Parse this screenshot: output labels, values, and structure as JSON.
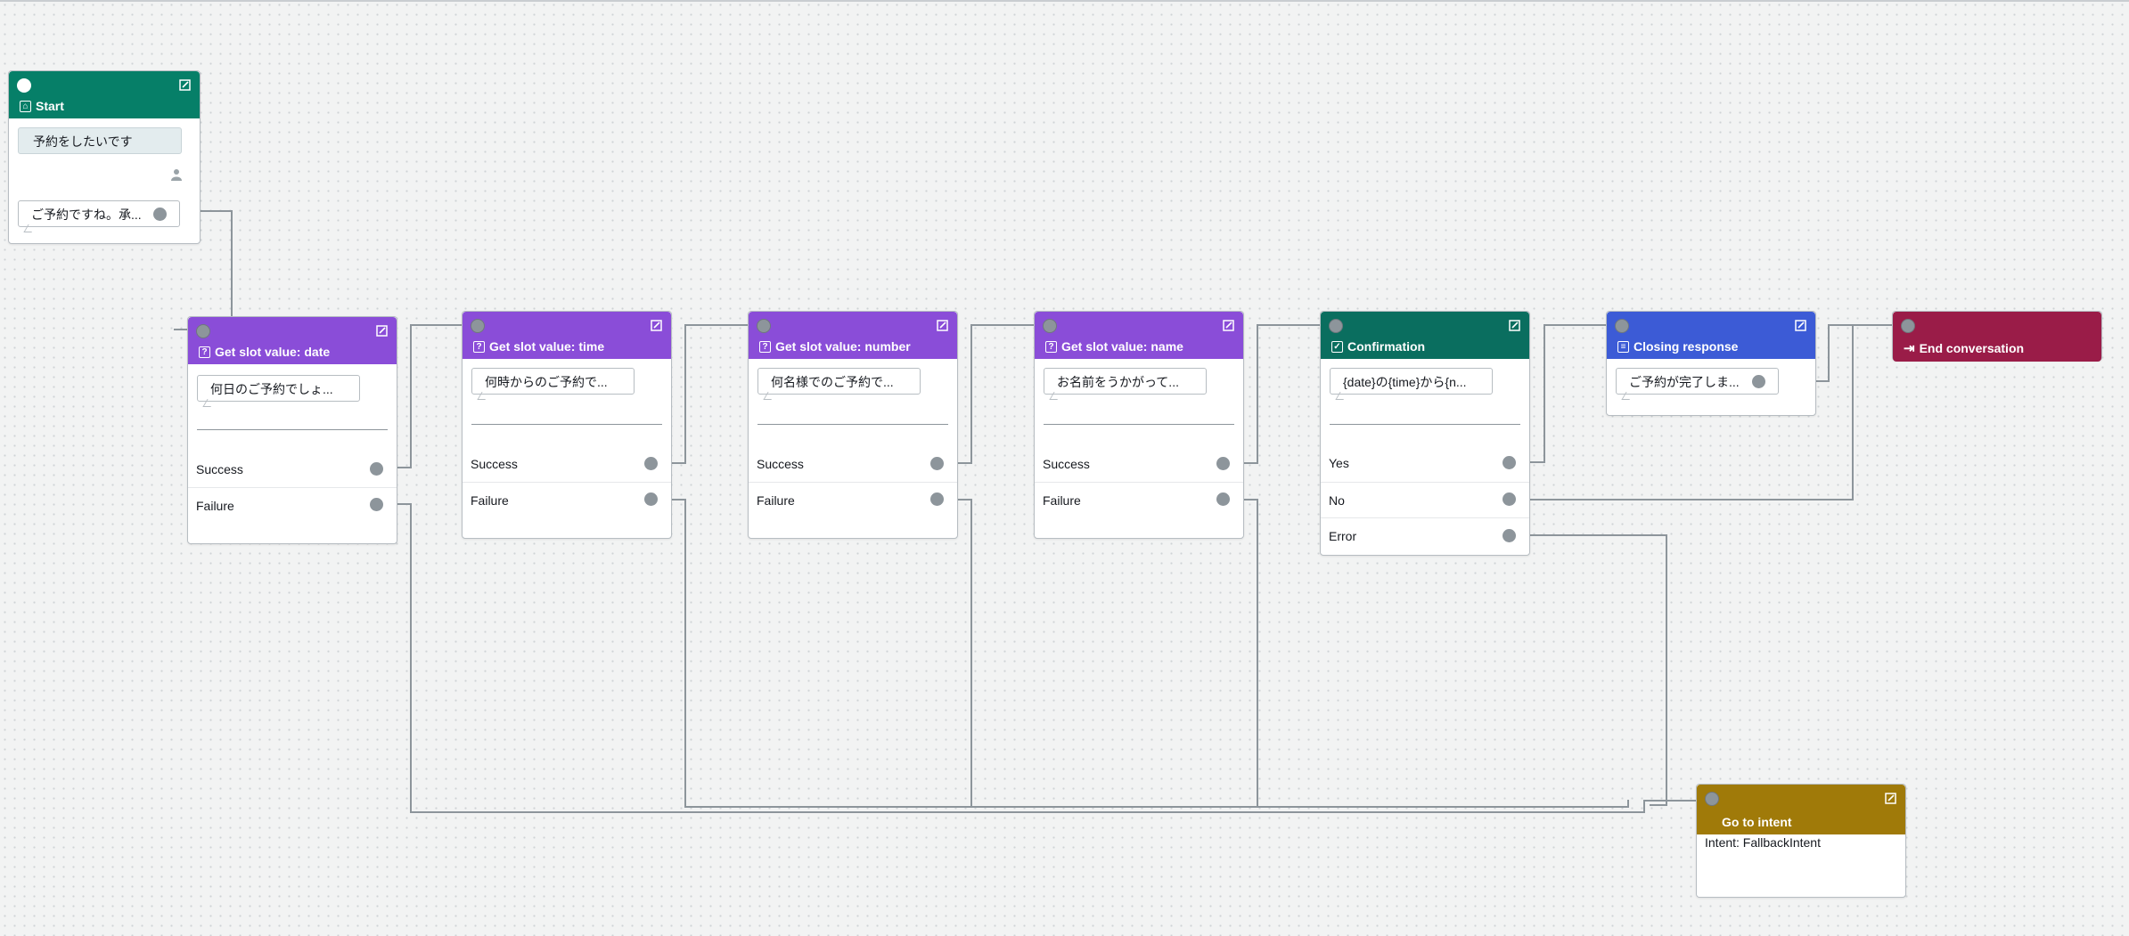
{
  "canvas": {
    "background": "#f2f3f3",
    "wire_color": "#8d959b"
  },
  "colors": {
    "start": "#067f68",
    "slot": "#8a4dd8",
    "confirmation": "#0a6e5f",
    "closing": "#3c5bd6",
    "end": "#9a1c48",
    "goto": "#a07a09"
  },
  "icons": {
    "edit": "edit-icon",
    "start": "start-icon",
    "question": "question-icon",
    "check": "check-icon",
    "message": "message-icon",
    "exit": "exit-icon",
    "user": "user-icon"
  },
  "nodes": {
    "start": {
      "title": "Start",
      "user_utterance": "予約をしたいです",
      "response": "ご予約ですね。承..."
    },
    "slot_date": {
      "title": "Get slot value: date",
      "prompt": "何日のご予約でしょ...",
      "branches": [
        "Success",
        "Failure"
      ]
    },
    "slot_time": {
      "title": "Get slot value: time",
      "prompt": "何時からのご予約で...",
      "branches": [
        "Success",
        "Failure"
      ]
    },
    "slot_number": {
      "title": "Get slot value: number",
      "prompt": "何名様でのご予約で...",
      "branches": [
        "Success",
        "Failure"
      ]
    },
    "slot_name": {
      "title": "Get slot value: name",
      "prompt": "お名前をうかがって...",
      "branches": [
        "Success",
        "Failure"
      ]
    },
    "confirmation": {
      "title": "Confirmation",
      "prompt": "{date}の{time}から{n...",
      "branches": [
        "Yes",
        "No",
        "Error"
      ]
    },
    "closing": {
      "title": "Closing response",
      "prompt": "ご予約が完了しま..."
    },
    "end": {
      "title": "End conversation"
    },
    "goto": {
      "title": "Go to intent",
      "intent": "Intent: FallbackIntent"
    }
  }
}
